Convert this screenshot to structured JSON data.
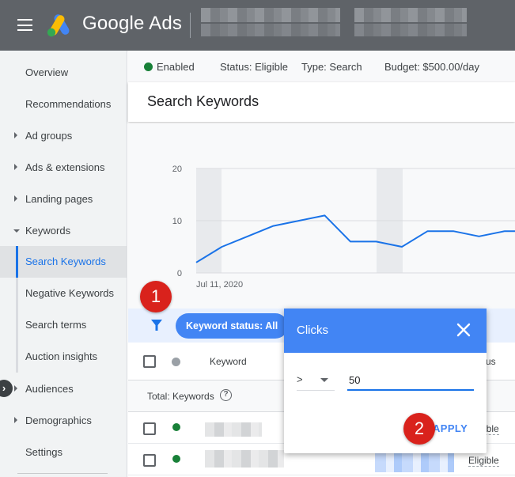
{
  "header": {
    "brand": "Google Ads"
  },
  "sidebar": {
    "items": [
      {
        "label": "Overview"
      },
      {
        "label": "Recommendations"
      },
      {
        "label": "Ad groups"
      },
      {
        "label": "Ads & extensions"
      },
      {
        "label": "Landing pages"
      },
      {
        "label": "Keywords"
      },
      {
        "label": "Search Keywords"
      },
      {
        "label": "Negative Keywords"
      },
      {
        "label": "Search terms"
      },
      {
        "label": "Auction insights"
      },
      {
        "label": "Audiences"
      },
      {
        "label": "Demographics"
      },
      {
        "label": "Settings"
      }
    ]
  },
  "status": {
    "enabled": "Enabled",
    "status": "Status: Eligible",
    "type": "Type: Search",
    "budget": "Budget: $500.00/day"
  },
  "page": {
    "title": "Search Keywords"
  },
  "chart_data": {
    "type": "line",
    "x_start_label": "Jul 11, 2020",
    "ylim": [
      0,
      20
    ],
    "yticks": [
      "0",
      "10",
      "20"
    ],
    "values": [
      2,
      5,
      7,
      9,
      10,
      11,
      6,
      6,
      5,
      8,
      8,
      7,
      8,
      8
    ],
    "grid": true,
    "line_color": "#1a73e8"
  },
  "filter": {
    "chip": "Keyword status: All"
  },
  "table": {
    "header_keyword": "Keyword",
    "header_status_partial": "us",
    "total_label": "Total: Keywords",
    "help_glyph": "?",
    "rows": [
      {
        "status": "Eligible"
      },
      {
        "status": "Eligible"
      }
    ]
  },
  "popup": {
    "title": "Clicks",
    "operator": ">",
    "value": "50",
    "apply": "APPLY"
  },
  "steps": {
    "one": "1",
    "two": "2"
  }
}
